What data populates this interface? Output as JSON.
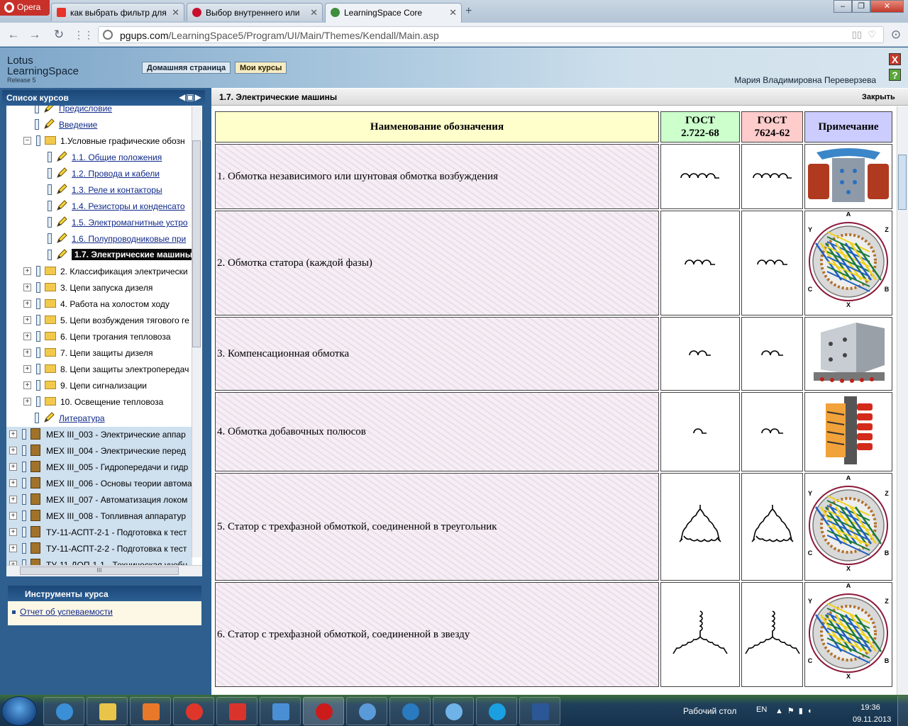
{
  "browser": {
    "app_name": "Opera",
    "tabs": [
      {
        "label": "как выбрать фильтр для"
      },
      {
        "label": "Выбор внутреннего или"
      },
      {
        "label": "LearningSpace Core",
        "active": true
      }
    ],
    "url_domain": "pgups.com",
    "url_path": "/LearningSpace5/Program/UI/Main/Themes/Kendall/Main.asp"
  },
  "header": {
    "logo_line1": "Lotus",
    "logo_line2": "LearningSpace",
    "logo_release": "Release 5",
    "nav_home": "Домашняя страница",
    "nav_my_courses": "Мои курсы",
    "user_name": "Мария Владимировна Переверзева",
    "close_btn": "X",
    "help_btn": "?"
  },
  "sidebar": {
    "title": "Список курсов",
    "tree": [
      {
        "label": "Предисловие",
        "type": "page",
        "link": true
      },
      {
        "label": "Введение",
        "type": "page",
        "link": true
      },
      {
        "label": "1.Условные графические обозн",
        "type": "folder",
        "expanded": true
      },
      {
        "label": "1.1. Общие положения",
        "type": "page",
        "link": true
      },
      {
        "label": "1.2. Провода и кабели",
        "type": "page",
        "link": true
      },
      {
        "label": "1.3. Реле и контакторы",
        "type": "page",
        "link": true
      },
      {
        "label": "1.4. Резисторы и конденсато",
        "type": "page",
        "link": true
      },
      {
        "label": "1.5. Электромагнитные устро",
        "type": "page",
        "link": true
      },
      {
        "label": "1.6. Полупроводниковые при",
        "type": "page",
        "link": true
      },
      {
        "label": "1.7. Электрические машины",
        "type": "page",
        "selected": true
      },
      {
        "label": "2. Классификация электрически",
        "type": "folder"
      },
      {
        "label": "3. Цепи запуска дизеля",
        "type": "folder"
      },
      {
        "label": "4. Работа на холостом ходу",
        "type": "folder"
      },
      {
        "label": "5. Цепи возбуждения тягового ге",
        "type": "folder"
      },
      {
        "label": "6. Цепи трогания тепловоза",
        "type": "folder"
      },
      {
        "label": "7. Цепи защиты дизеля",
        "type": "folder"
      },
      {
        "label": "8. Цепи защиты электропередач",
        "type": "folder"
      },
      {
        "label": "9. Цепи сигнализации",
        "type": "folder"
      },
      {
        "label": "10. Освещение тепловоза",
        "type": "folder"
      },
      {
        "label": "Литература",
        "type": "page",
        "link": true
      },
      {
        "label": "МЕХ III_003 - Электрические аппар",
        "type": "course"
      },
      {
        "label": "МЕХ III_004 - Электрические перед",
        "type": "course"
      },
      {
        "label": "МЕХ III_005 - Гидропередачи и гидр",
        "type": "course"
      },
      {
        "label": "МЕХ III_006 - Основы теории автома",
        "type": "course"
      },
      {
        "label": "МЕХ III_007 - Автоматизация локом",
        "type": "course"
      },
      {
        "label": "МЕХ III_008 - Топливная аппаратур",
        "type": "course"
      },
      {
        "label": "ТУ-11-АСПТ-2-1 - Подготовка к тест",
        "type": "course"
      },
      {
        "label": "ТУ-11-АСПТ-2-2 - Подготовка к тест",
        "type": "course"
      },
      {
        "label": "ТУ-11-ДОП-1-1 - Техническая учебн",
        "type": "course"
      }
    ],
    "tools_title": "Инструменты курса",
    "tools_link": "Отчет об успеваемости"
  },
  "main": {
    "title": "1.7. Электрические машины",
    "close_label": "Закрыть",
    "table": {
      "headers": {
        "name": "Наименование обозначения",
        "gost1_l1": "ГОСТ",
        "gost1_l2": "2.722-68",
        "gost2_l1": "ГОСТ",
        "gost2_l2": "7624-62",
        "note": "Примечание"
      },
      "rows": [
        {
          "name": "1. Обмотка независимого или шунтовая обмотка возбуждения",
          "symbol": "coil-4"
        },
        {
          "name": "2. Обмотка статора (каждой фазы)",
          "symbol": "coil-3"
        },
        {
          "name": "3. Компенсационная обмотка",
          "symbol": "coil-2"
        },
        {
          "name": "4. Обмотка добавочных полюсов",
          "symbol": "coil-1"
        },
        {
          "name": "5. Статор с трехфазной обмоткой, соединенной в треугольник",
          "symbol": "delta"
        },
        {
          "name": "6. Статор с трехфазной обмоткой, соединенной в звезду",
          "symbol": "star"
        }
      ],
      "stator_labels": [
        "A",
        "Z",
        "B",
        "X",
        "C",
        "Y"
      ]
    }
  },
  "taskbar": {
    "desktop_label": "Рабочий стол",
    "lang": "EN",
    "time": "19:36",
    "date": "09.11.2013"
  }
}
